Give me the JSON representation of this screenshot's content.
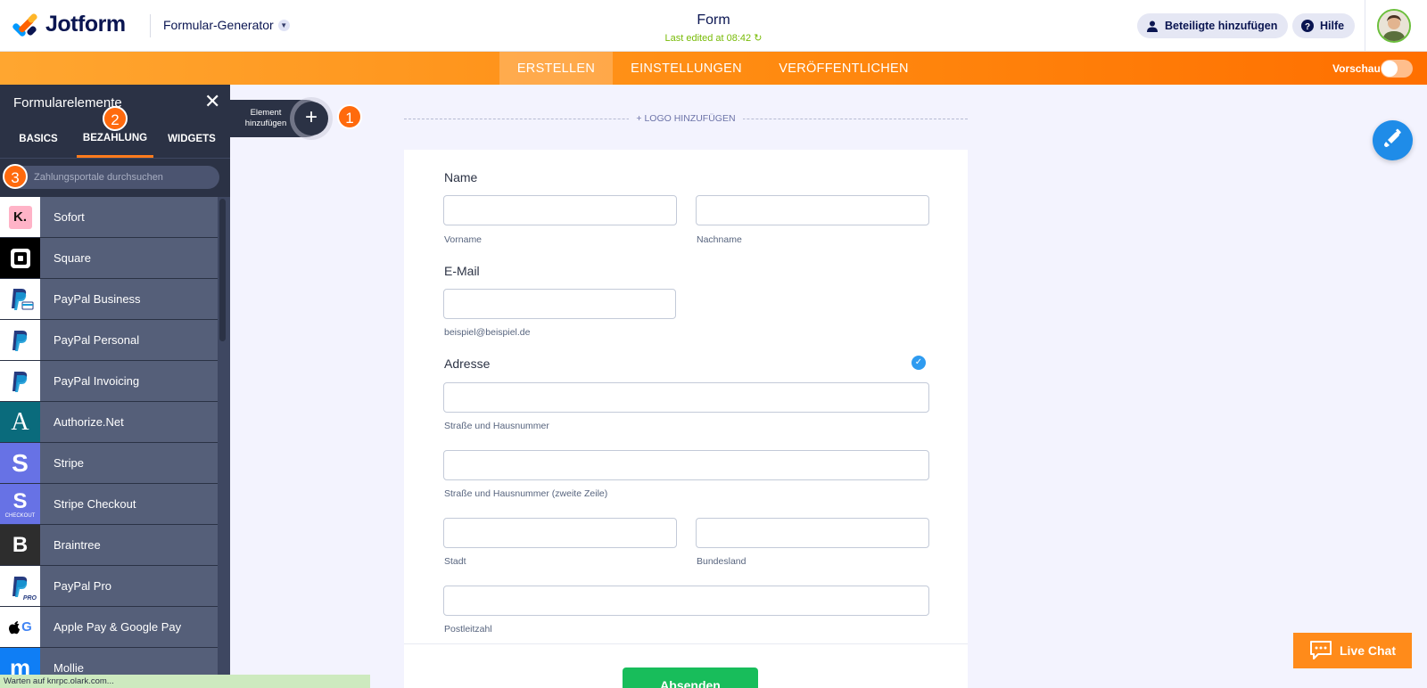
{
  "header": {
    "logo_text": "Jotform",
    "generator_label": "Formular-Generator",
    "form_title": "Form",
    "last_edited": "Last edited at 08:42",
    "invite_label": "Beteiligte hinzufügen",
    "help_label": "Hilfe"
  },
  "main_tabs": [
    {
      "label": "ERSTELLEN",
      "active": true
    },
    {
      "label": "EINSTELLUNGEN",
      "active": false
    },
    {
      "label": "VERÖFFENTLICHEN",
      "active": false
    }
  ],
  "preview": {
    "label": "Vorschau",
    "on": false
  },
  "sidebar": {
    "title": "Formularelemente",
    "tabs": [
      {
        "label": "BASICS",
        "active": false
      },
      {
        "label": "BEZAHLUNG",
        "active": true
      },
      {
        "label": "WIDGETS",
        "active": false
      }
    ],
    "search_placeholder": "Zahlungsportale durchsuchen",
    "items": [
      {
        "label": "Sofort",
        "icon": "klarna-icon"
      },
      {
        "label": "Square",
        "icon": "square-icon"
      },
      {
        "label": "PayPal Business",
        "icon": "paypal-business-icon"
      },
      {
        "label": "PayPal Personal",
        "icon": "paypal-icon"
      },
      {
        "label": "PayPal Invoicing",
        "icon": "paypal-icon"
      },
      {
        "label": "Authorize.Net",
        "icon": "authorize-net-icon"
      },
      {
        "label": "Stripe",
        "icon": "stripe-icon"
      },
      {
        "label": "Stripe Checkout",
        "icon": "stripe-checkout-icon"
      },
      {
        "label": "Braintree",
        "icon": "braintree-icon"
      },
      {
        "label": "PayPal Pro",
        "icon": "paypal-pro-icon"
      },
      {
        "label": "Apple Pay & Google Pay",
        "icon": "apple-google-pay-icon"
      },
      {
        "label": "Mollie",
        "icon": "mollie-icon"
      }
    ],
    "icon_texts": {
      "klarna": "K.",
      "authorize": "A",
      "stripe": "S",
      "checkout": "CHECKOUT",
      "braintree": "B",
      "pro": "PRO",
      "google": "G",
      "mollie": "m"
    }
  },
  "add_element": {
    "label": "Element hinzufügen",
    "plus": "+"
  },
  "badges": [
    "1",
    "2",
    "3"
  ],
  "canvas": {
    "logo_add": "+ LOGO HINZUFÜGEN",
    "fields": {
      "name_label": "Name",
      "first_name_sub": "Vorname",
      "last_name_sub": "Nachname",
      "email_label": "E-Mail",
      "email_sub": "beispiel@beispiel.de",
      "address_label": "Adresse",
      "street_sub": "Straße und Hausnummer",
      "street2_sub": "Straße und Hausnummer (zweite Zeile)",
      "city_sub": "Stadt",
      "state_sub": "Bundesland",
      "zip_sub": "Postleitzahl"
    },
    "submit_label": "Absenden"
  },
  "livechat_label": "Live Chat",
  "statusbar": "Warten auf knrpc.olark.com...",
  "colors": {
    "accent": "#ff7b1c",
    "submit": "#18bd5b",
    "sidebar": "#3e4761",
    "link_blue": "#1f8ce8"
  }
}
